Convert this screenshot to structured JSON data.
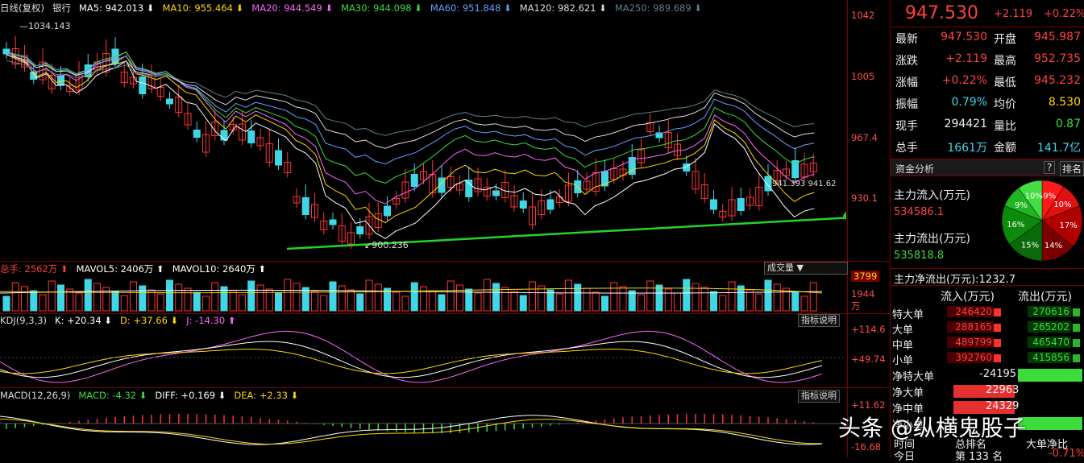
{
  "main_chart": {
    "indicators": [
      {
        "label": "日线(复权)",
        "color": "#dddddd"
      },
      {
        "label": "银行",
        "color": "#dddddd"
      },
      {
        "label": "MA5: 942.013 ⬇",
        "color": "#ffffff"
      },
      {
        "label": "MA10: 955.464 ⬇",
        "color": "#ffd800"
      },
      {
        "label": "MA20: 944.549 ⬇",
        "color": "#ff66ff"
      },
      {
        "label": "MA30: 944.098 ⬇",
        "color": "#3ddc3d"
      },
      {
        "label": "MA60: 951.848 ⬇",
        "color": "#66a0ff"
      },
      {
        "label": "MA120: 982.621 ⬇",
        "color": "#dddddd"
      },
      {
        "label": "MA250: 989.689 ⬇",
        "color": "#5f7f8f"
      }
    ],
    "y_ticks": [
      "1042",
      "1005",
      "967.4",
      "930.1"
    ],
    "annotations": {
      "high": "1034.143",
      "low": "900.236",
      "ma_pair": "941.393 941.62"
    }
  },
  "volume_panel": {
    "labels": [
      {
        "text": "总手: 2562万 ⬆",
        "color": "#ff4040"
      },
      {
        "text": "MAVOL5: 2406万 ⬆",
        "color": "#ffffff"
      },
      {
        "text": "MAVOL10: 2640万 ⬆",
        "color": "#ffffff"
      }
    ],
    "dropdown": "成交量 ▼",
    "y_ticks": [
      "3799",
      "1944",
      "万"
    ]
  },
  "kdj_panel": {
    "labels": [
      {
        "text": "KDJ(9,3,3)",
        "color": "#dddddd"
      },
      {
        "text": "K: +20.34 ⬇",
        "color": "#ffffff"
      },
      {
        "text": "D: +37.66 ⬇",
        "color": "#ffd800"
      },
      {
        "text": "J: -14.30 ⬆",
        "color": "#ff66ff"
      }
    ],
    "button": "指标说明",
    "y_ticks": [
      "+114.6",
      "+49.74"
    ]
  },
  "macd_panel": {
    "labels": [
      {
        "text": "MACD(12,26,9)",
        "color": "#dddddd"
      },
      {
        "text": "MACD: -4.32 ⬇",
        "color": "#3ddc3d"
      },
      {
        "text": "DIFF: +0.169 ⬇",
        "color": "#ffffff"
      },
      {
        "text": "DEA: +2.33 ⬇",
        "color": "#ffd800"
      }
    ],
    "button": "指标说明",
    "y_ticks": [
      "+11.62",
      "-16.68"
    ]
  },
  "quote": {
    "price": "947.530",
    "change": "+2.119",
    "pct": "+0.22%",
    "rows": [
      {
        "l1": "最新",
        "v1": "947.530",
        "c1": "#ff4040",
        "l2": "开盘",
        "v2": "945.987",
        "c2": "#ff4040"
      },
      {
        "l1": "涨跌",
        "v1": "+2.119",
        "c1": "#ff4040",
        "l2": "最高",
        "v2": "952.735",
        "c2": "#ff4040"
      },
      {
        "l1": "涨幅",
        "v1": "+0.22%",
        "c1": "#ff4040",
        "l2": "最低",
        "v2": "945.232",
        "c2": "#ff4040"
      },
      {
        "l1": "振幅",
        "v1": "0.79%",
        "c1": "#3fd7e6",
        "l2": "均价",
        "v2": "8.530",
        "c2": "#ffd800"
      },
      {
        "l1": "现手",
        "v1": "294421",
        "c1": "#eeeeee",
        "l2": "量比",
        "v2": "0.87",
        "c2": "#3ddc3d"
      },
      {
        "l1": "总手",
        "v1": "1661万",
        "c1": "#3fd7e6",
        "l2": "金额",
        "v2": "141.7亿",
        "c2": "#3fd7e6"
      }
    ]
  },
  "fund": {
    "title": "资金分析",
    "q": "?",
    "rank": "排名",
    "inflow_label": "主力流入(万元)",
    "inflow_value": "534586.1",
    "outflow_label": "主力流出(万元)",
    "outflow_value": "535818.8",
    "net_label": "主力净流出(万元):",
    "net_value": "1232.7",
    "pie": [
      {
        "label": "9%",
        "value": 9,
        "color": "#ff1a1a"
      },
      {
        "label": "10%",
        "value": 10,
        "color": "#e01010"
      },
      {
        "label": "17%",
        "value": 17,
        "color": "#b00000"
      },
      {
        "label": "14%",
        "value": 14,
        "color": "#7a0000"
      },
      {
        "label": "15%",
        "value": 15,
        "color": "#0a6a0a"
      },
      {
        "label": "16%",
        "value": 16,
        "color": "#0c8a0c"
      },
      {
        "label": "9%",
        "value": 9,
        "color": "#22b522"
      },
      {
        "label": "10%",
        "value": 10,
        "color": "#44dd44"
      }
    ],
    "table_headers": [
      "流入(万元)",
      "流出(万元)"
    ],
    "table_rows": [
      {
        "name": "特大单",
        "in": "246420",
        "out": "270616"
      },
      {
        "name": "大单",
        "in": "288165",
        "out": "265202"
      },
      {
        "name": "中单",
        "in": "489799",
        "out": "465470"
      },
      {
        "name": "小单",
        "in": "392760",
        "out": "415856"
      }
    ],
    "net_rows": [
      {
        "name": "净特大单",
        "value": "-24195",
        "color": "#3ddc3d"
      },
      {
        "name": "净大单",
        "value": "22963",
        "color": "#e53030"
      },
      {
        "name": "净中单",
        "value": "24329",
        "color": "#e53030"
      },
      {
        "name": "净小单",
        "value": "",
        "color": "#3ddc3d"
      }
    ],
    "footer": {
      "time": "时间",
      "rank": "总排名",
      "big": "大单净比",
      "today": "今日",
      "rank_val": "第 133 名",
      "big_val": "-0.71%"
    }
  },
  "watermark": "头条 @纵横鬼股子"
}
